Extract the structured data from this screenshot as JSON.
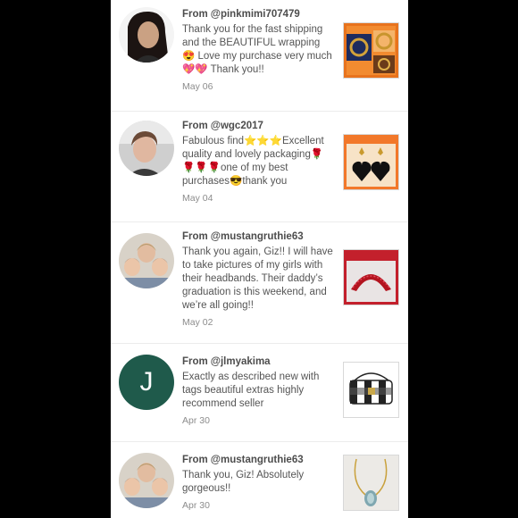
{
  "reviews": [
    {
      "from_prefix": "From",
      "username": "@pinkmimi707479",
      "message": "Thank you for the fast shipping and the BEAUTIFUL wrapping 😍 Love my purchase very much 💖💖 Thank you!!",
      "date": "May 06",
      "avatar_type": "photo",
      "thumb_icon": "orange-gold-bracelets-listing-thumb"
    },
    {
      "from_prefix": "From",
      "username": "@wgc2017",
      "message": "Fabulous find⭐⭐⭐Excellent quality and lovely packaging🌹🌹🌹🌹one of my best purchases😎thank you",
      "date": "May 04",
      "avatar_type": "photo",
      "thumb_icon": "black-heart-earrings-listing-thumb"
    },
    {
      "from_prefix": "From",
      "username": "@mustangruthie63",
      "message": "Thank you again, Giz!! I will have to take pictures of my girls with their headbands. Their daddy’s graduation is this weekend, and we’re all going!!",
      "date": "May 02",
      "avatar_type": "photo",
      "thumb_icon": "red-beaded-headband-listing-thumb"
    },
    {
      "from_prefix": "From",
      "username": "@jlmyakima",
      "message": "Exactly as described new with tags beautiful extras highly recommend seller",
      "date": "Apr 30",
      "avatar_type": "letter",
      "avatar_letter": "J",
      "thumb_icon": "plaid-bag-listing-thumb"
    },
    {
      "from_prefix": "From",
      "username": "@mustangruthie63",
      "message": "Thank you, Giz! Absolutely gorgeous!!",
      "date": "Apr 30",
      "avatar_type": "photo",
      "thumb_icon": "gold-necklace-listing-thumb"
    }
  ],
  "colors": {
    "background": "#000000",
    "panel": "#ffffff",
    "letter_avatar": "#1f5a4b",
    "username": "#4d4d4d",
    "message": "#555555",
    "date": "#8c8c8c"
  }
}
